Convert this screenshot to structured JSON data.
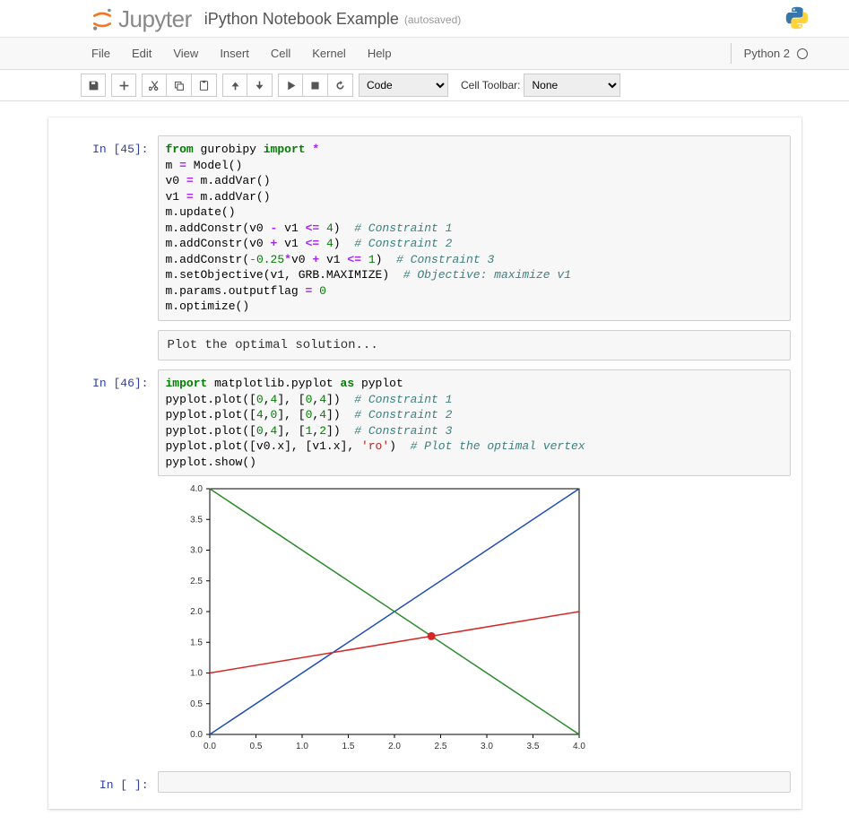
{
  "header": {
    "logo_text": "Jupyter",
    "notebook_name": "iPython Notebook Example",
    "autosave": "(autosaved)"
  },
  "menubar": {
    "items": [
      "File",
      "Edit",
      "View",
      "Insert",
      "Cell",
      "Kernel",
      "Help"
    ],
    "kernel": "Python 2"
  },
  "toolbar": {
    "celltype_value": "Code",
    "cell_toolbar_label": "Cell Toolbar:",
    "cell_toolbar_value": "None"
  },
  "cells": {
    "c45": {
      "prompt": "In [45]:"
    },
    "md": {
      "text": "Plot the optimal solution..."
    },
    "c46": {
      "prompt": "In [46]:"
    },
    "cempty": {
      "prompt": "In [ ]:"
    }
  },
  "code": {
    "c45": {
      "l1_kw1": "from",
      "l1_n1": " gurobipy ",
      "l1_kw2": "import",
      "l1_op": " *",
      "l2": "m ",
      "l2_op": "=",
      "l2b": " Model()",
      "l3": "v0 ",
      "l3_op": "=",
      "l3b": " m.addVar()",
      "l4": "v1 ",
      "l4_op": "=",
      "l4b": " m.addVar()",
      "l5": "m.update()",
      "l6a": "m.addConstr(v0 ",
      "l6_op1": "-",
      "l6b": " v1 ",
      "l6_op2": "<=",
      "l6c": " ",
      "l6n": "4",
      "l6d": ")  ",
      "l6cm": "# Constraint 1",
      "l7a": "m.addConstr(v0 ",
      "l7_op1": "+",
      "l7b": " v1 ",
      "l7_op2": "<=",
      "l7c": " ",
      "l7n": "4",
      "l7d": ")  ",
      "l7cm": "# Constraint 2",
      "l8a": "m.addConstr(",
      "l8neg": "-",
      "l8n1": "0.25",
      "l8op": "*",
      "l8b": "v0 ",
      "l8_op1": "+",
      "l8c": " v1 ",
      "l8_op2": "<=",
      "l8d": " ",
      "l8n2": "1",
      "l8e": ")  ",
      "l8cm": "# Constraint 3",
      "l9a": "m.setObjective(v1, GRB.MAXIMIZE)  ",
      "l9cm": "# Objective: maximize v1",
      "l10a": "m.params.outputflag ",
      "l10_op": "=",
      "l10b": " ",
      "l10n": "0",
      "l11": "m.optimize()"
    },
    "c46": {
      "l1_kw1": "import",
      "l1_n1": " matplotlib.pyplot ",
      "l1_kw2": "as",
      "l1_n2": " pyplot",
      "l2a": "pyplot.plot([",
      "l2n1": "0",
      "l2b": ",",
      "l2n2": "4",
      "l2c": "], [",
      "l2n3": "0",
      "l2d": ",",
      "l2n4": "4",
      "l2e": "])  ",
      "l2cm": "# Constraint 1",
      "l3a": "pyplot.plot([",
      "l3n1": "4",
      "l3b": ",",
      "l3n2": "0",
      "l3c": "], [",
      "l3n3": "0",
      "l3d": ",",
      "l3n4": "4",
      "l3e": "])  ",
      "l3cm": "# Constraint 2",
      "l4a": "pyplot.plot([",
      "l4n1": "0",
      "l4b": ",",
      "l4n2": "4",
      "l4c": "], [",
      "l4n3": "1",
      "l4d": ",",
      "l4n4": "2",
      "l4e": "])  ",
      "l4cm": "# Constraint 3",
      "l5a": "pyplot.plot([v0.x], [v1.x], ",
      "l5s": "'ro'",
      "l5b": ")  ",
      "l5cm": "# Plot the optimal vertex",
      "l6": "pyplot.show()"
    }
  },
  "chart_data": {
    "type": "line",
    "xlim": [
      0.0,
      4.0
    ],
    "ylim": [
      0.0,
      4.0
    ],
    "xticks": [
      0.0,
      0.5,
      1.0,
      1.5,
      2.0,
      2.5,
      3.0,
      3.5,
      4.0
    ],
    "yticks": [
      0.0,
      0.5,
      1.0,
      1.5,
      2.0,
      2.5,
      3.0,
      3.5,
      4.0
    ],
    "series": [
      {
        "name": "Constraint 1",
        "x": [
          0,
          4
        ],
        "y": [
          0,
          4
        ],
        "color": "#1f4db3"
      },
      {
        "name": "Constraint 2",
        "x": [
          4,
          0
        ],
        "y": [
          0,
          4
        ],
        "color": "#2a8a2a"
      },
      {
        "name": "Constraint 3",
        "x": [
          0,
          4
        ],
        "y": [
          1,
          2
        ],
        "color": "#d62728"
      }
    ],
    "points": [
      {
        "name": "Optimal vertex",
        "x": 2.4,
        "y": 1.6,
        "color": "#d62728"
      }
    ]
  }
}
